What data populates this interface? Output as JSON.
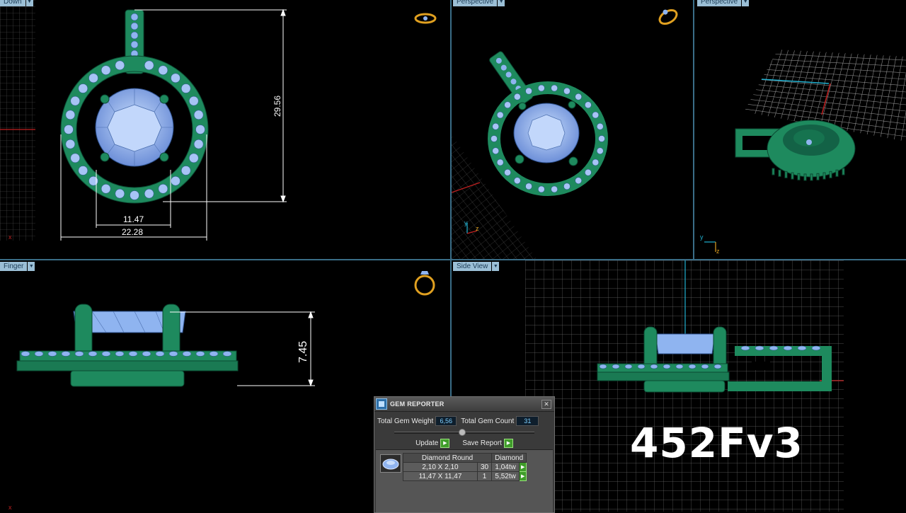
{
  "viewports": {
    "top_left": {
      "label": "Down",
      "dims": {
        "height": "29.56",
        "inner_width": "11.47",
        "outer_width": "22.28"
      }
    },
    "top_middle": {
      "label": "Perspective"
    },
    "top_right": {
      "label": "Perspective"
    },
    "bottom_left": {
      "label": "Finger",
      "dims": {
        "height": "7.45"
      }
    },
    "bottom_right": {
      "label": "Side View"
    }
  },
  "axis_labels": {
    "x": "x",
    "y": "y",
    "z": "z"
  },
  "gem_reporter": {
    "title": "GEM REPORTER",
    "total_weight_label": "Total Gem Weight",
    "total_weight_value": "6,56",
    "total_count_label": "Total Gem Count",
    "total_count_value": "31",
    "update_label": "Update",
    "save_report_label": "Save Report",
    "close_glyph": "✕",
    "go_glyph": "▶",
    "table": {
      "headers": [
        "Diamond Round",
        "Diamond"
      ],
      "rows": [
        {
          "size": "2,10 X 2,10",
          "count": "30",
          "weight": "1,04tw"
        },
        {
          "size": "11,47 X 11,47",
          "count": "1",
          "weight": "5,52tw"
        }
      ]
    }
  },
  "model_code": "452Fv3",
  "colors": {
    "metal": "#1e8a5e",
    "gem": "#8fb4f0",
    "viewport_border": "#3a6d87",
    "label_bg": "#9bbfd6",
    "grid": "#5a5a5a",
    "accent_gold": "#e0a020"
  }
}
